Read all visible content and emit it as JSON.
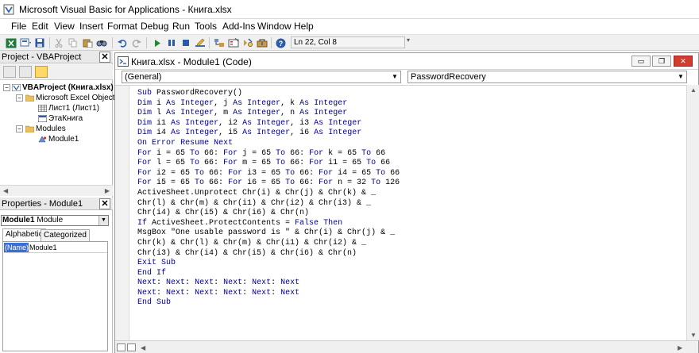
{
  "window": {
    "title": "Microsoft Visual Basic for Applications - Книга.xlsx"
  },
  "menu": [
    "File",
    "Edit",
    "View",
    "Insert",
    "Format",
    "Debug",
    "Run",
    "Tools",
    "Add-Ins",
    "Window",
    "Help"
  ],
  "toolbar": {
    "cursor_position": "Ln 22, Col 8"
  },
  "project_panel": {
    "title": "Project - VBAProject",
    "tree": {
      "root": "VBAProject (Книга.xlsx)",
      "excel_objects": "Microsoft Excel Objects",
      "sheet1": "Лист1 (Лист1)",
      "workbook": "ЭтаКнига",
      "modules": "Modules",
      "module1": "Module1"
    }
  },
  "properties_panel": {
    "title": "Properties - Module1",
    "object_name": "Module1",
    "object_type": "Module",
    "tabs": [
      "Alphabetic",
      "Categorized"
    ],
    "rows": [
      {
        "name": "(Name)",
        "value": "Module1"
      }
    ]
  },
  "code_window": {
    "title": "Книга.xlsx - Module1 (Code)",
    "object_combo": "(General)",
    "procedure_combo": "PasswordRecovery",
    "lines": [
      "Sub PasswordRecovery()",
      "Dim i As Integer, j As Integer, k As Integer",
      "Dim l As Integer, m As Integer, n As Integer",
      "Dim i1 As Integer, i2 As Integer, i3 As Integer",
      "Dim i4 As Integer, i5 As Integer, i6 As Integer",
      "On Error Resume Next",
      "For i = 65 To 66: For j = 65 To 66: For k = 65 To 66",
      "For l = 65 To 66: For m = 65 To 66: For i1 = 65 To 66",
      "For i2 = 65 To 66: For i3 = 65 To 66: For i4 = 65 To 66",
      "For i5 = 65 To 66: For i6 = 65 To 66: For n = 32 To 126",
      "ActiveSheet.Unprotect Chr(i) & Chr(j) & Chr(k) & _",
      "Chr(l) & Chr(m) & Chr(i1) & Chr(i2) & Chr(i3) & _",
      "Chr(i4) & Chr(i5) & Chr(i6) & Chr(n)",
      "If ActiveSheet.ProtectContents = False Then",
      "MsgBox \"One usable password is \" & Chr(i) & Chr(j) & _",
      "Chr(k) & Chr(l) & Chr(m) & Chr(i1) & Chr(i2) & _",
      "Chr(i3) & Chr(i4) & Chr(i5) & Chr(i6) & Chr(n)",
      "Exit Sub",
      "End If",
      "Next: Next: Next: Next: Next: Next",
      "Next: Next: Next: Next: Next: Next",
      "End Sub"
    ]
  },
  "colors": {
    "keyword": "#00008b",
    "selection": "#3a6fd8",
    "close_button": "#d23c2f"
  }
}
